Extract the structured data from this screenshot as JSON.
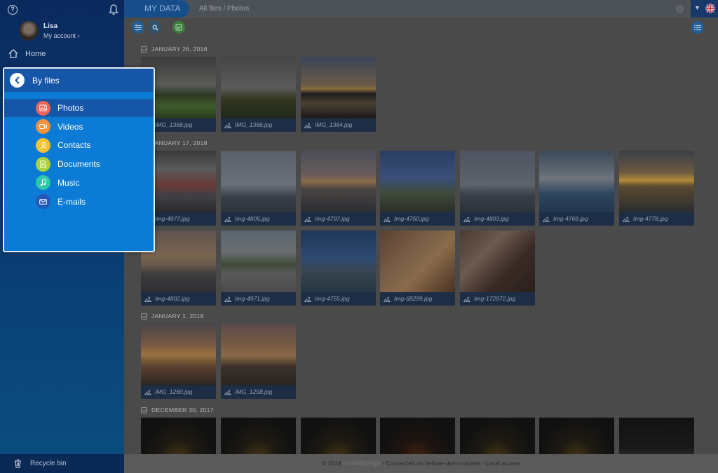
{
  "sidebar": {
    "user_name": "Lisa",
    "account_label": "My account",
    "home_label": "Home",
    "recycle_label": "Recycle bin"
  },
  "header": {
    "tab_label": "MY DATA",
    "breadcrumb": "All files / Photos"
  },
  "popup": {
    "title": "By files",
    "items": [
      {
        "label": "Photos",
        "color": "#f0645a",
        "icon": "image-icon"
      },
      {
        "label": "Videos",
        "color": "#f5913c",
        "icon": "video-icon"
      },
      {
        "label": "Contacts",
        "color": "#f5c230",
        "icon": "contact-icon"
      },
      {
        "label": "Documents",
        "color": "#a8d43a",
        "icon": "document-icon"
      },
      {
        "label": "Music",
        "color": "#2ec6a8",
        "icon": "music-icon"
      },
      {
        "label": "E-mails",
        "color": "#2458b8",
        "icon": "mail-icon"
      }
    ]
  },
  "groups": [
    {
      "date": "JANUARY 26, 2018",
      "files": [
        {
          "name": "IMG_1368.jpg",
          "scene": "park"
        },
        {
          "name": "IMG_1366.jpg",
          "scene": "trees"
        },
        {
          "name": "IMG_1364.jpg",
          "scene": "sunset-lake"
        }
      ]
    },
    {
      "date": "JANUARY 17, 2018",
      "files": [
        {
          "name": "Img-4977.jpg",
          "scene": "market"
        },
        {
          "name": "Img-4805.jpg",
          "scene": "ship"
        },
        {
          "name": "Img-4797.jpg",
          "scene": "sunset-sea"
        },
        {
          "name": "Img-4750.jpg",
          "scene": "flag-palm"
        },
        {
          "name": "Img-4803.jpg",
          "scene": "ship-dusk"
        },
        {
          "name": "Img-4769.jpg",
          "scene": "yacht"
        },
        {
          "name": "Img-4778.jpg",
          "scene": "sunset-gold"
        },
        {
          "name": "Img-4802.jpg",
          "scene": "shore-dusk"
        },
        {
          "name": "Img-4971.jpg",
          "scene": "street"
        },
        {
          "name": "Img-4755.jpg",
          "scene": "marina"
        },
        {
          "name": "Img-68299.jpg",
          "scene": "food"
        },
        {
          "name": "Img-172972.jpg",
          "scene": "party"
        }
      ]
    },
    {
      "date": "JANUARY 1, 2018",
      "files": [
        {
          "name": "IMG_1260.jpg",
          "scene": "cloud-sunset"
        },
        {
          "name": "IMG_1258.jpg",
          "scene": "road-sunset"
        }
      ]
    },
    {
      "date": "DECEMBER 30, 2017",
      "files": [
        {
          "name": "",
          "scene": "eiffel"
        },
        {
          "name": "",
          "scene": "eiffel"
        },
        {
          "name": "",
          "scene": "eiffel"
        },
        {
          "name": "",
          "scene": "eiffel-red"
        },
        {
          "name": "",
          "scene": "eiffel"
        },
        {
          "name": "",
          "scene": "eiffel"
        },
        {
          "name": "",
          "scene": "cathedral"
        }
      ]
    }
  ],
  "footer": {
    "copyright": "© 2018",
    "brand": "novothings",
    "status": "- Connected on helixee-demo-nantes - Local access"
  }
}
